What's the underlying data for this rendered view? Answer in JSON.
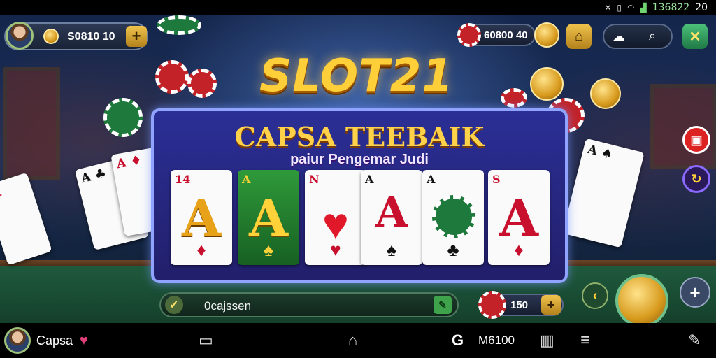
{
  "status_bar": {
    "time": "20",
    "network_text": "136822",
    "icons": [
      "mute-icon",
      "vibrate-icon",
      "wifi-icon",
      "signal-icon"
    ]
  },
  "player": {
    "coins": "S0810 10",
    "plus_label": "+"
  },
  "top_right": {
    "gems": "60800 40",
    "search_icon": "search-icon",
    "close_label": "✕"
  },
  "logo": "SLOT21",
  "panel": {
    "title": "CAPSA TEEBAIK",
    "subtitle": "paiur Pengemar Judi",
    "cards": [
      {
        "rank": "A",
        "corner": "14",
        "suit": "♦",
        "style": "gold"
      },
      {
        "rank": "A",
        "corner": "A",
        "suit": "♠",
        "style": "green"
      },
      {
        "rank": "N",
        "corner": "N",
        "suit": "♥",
        "style": "red"
      },
      {
        "rank": "A",
        "corner": "A",
        "suit": "♠",
        "style": "black"
      },
      {
        "rank": "A",
        "corner": "A",
        "suit": "♣",
        "style": "chip"
      },
      {
        "rank": "A",
        "corner": "S",
        "suit": "♦",
        "style": "red"
      }
    ]
  },
  "bottom": {
    "input_value": "0cajssen",
    "bet_value": "150",
    "bet_plus": "+"
  },
  "nav_bar": {
    "username": "Capsa",
    "counter_text": "M6100"
  },
  "colors": {
    "gold": "#ffcf3a",
    "panel_blue": "#2b2f96",
    "felt_green": "#1f5a3d",
    "chip_red": "#c22228"
  }
}
